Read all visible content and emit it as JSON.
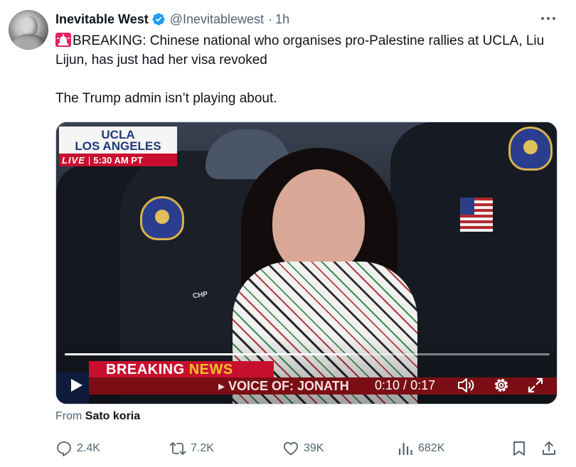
{
  "author": {
    "display_name": "Inevitable West",
    "handle": "@Inevitablewest",
    "separator": "·",
    "time": "1h",
    "verified": true
  },
  "tweet": {
    "line1": "BREAKING: Chinese national who organises pro-Palestine rallies at UCLA, Liu Lijun, has just had her visa revoked",
    "line2": "The Trump admin isn’t playing about.",
    "emoji": "siren-icon"
  },
  "video": {
    "location_line1": "UCLA",
    "location_line2": "LOS ANGELES",
    "live_tag": "LIVE",
    "live_separator": "|",
    "live_time": "5:30 AM PT",
    "breaking_word": "BREAKING",
    "news_word": "NEWS",
    "ticker_text": "▸ VOICE OF: JONATH",
    "badge_text": "CHP",
    "current_time": "0:10",
    "time_separator": " / ",
    "duration": "0:17",
    "progress_fraction": 0.59,
    "source_prefix": "From",
    "source_name": "Sato koria"
  },
  "actions": {
    "replies": "2.4K",
    "reposts": "7.2K",
    "likes": "39K",
    "views": "682K"
  },
  "colors": {
    "accent": "#1d9bf0",
    "text": "#0f1419",
    "muted": "#536471",
    "breaking_red": "#c8102e",
    "news_yellow": "#f1c12b"
  }
}
